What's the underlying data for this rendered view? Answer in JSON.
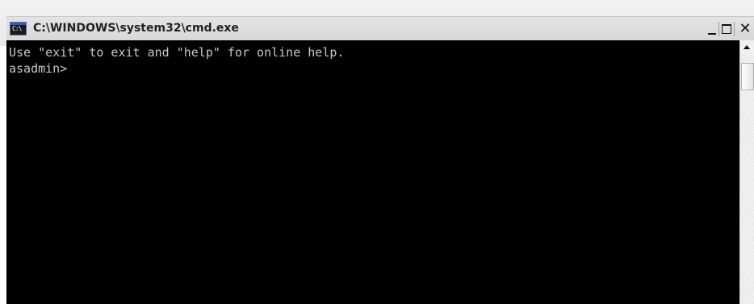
{
  "window": {
    "title": "C:\\WINDOWS\\system32\\cmd.exe",
    "app_icon_glyph": "C:\\"
  },
  "console": {
    "lines": [
      "Use \"exit\" to exit and \"help\" for online help.",
      "asadmin>"
    ],
    "background_color": "#000000",
    "text_color": "#c8c8c8"
  },
  "icons": {
    "app": "console-icon",
    "minimize": "minimize-icon",
    "maximize": "maximize-icon",
    "close": "close-icon",
    "scroll_up": "arrow-up-icon"
  }
}
